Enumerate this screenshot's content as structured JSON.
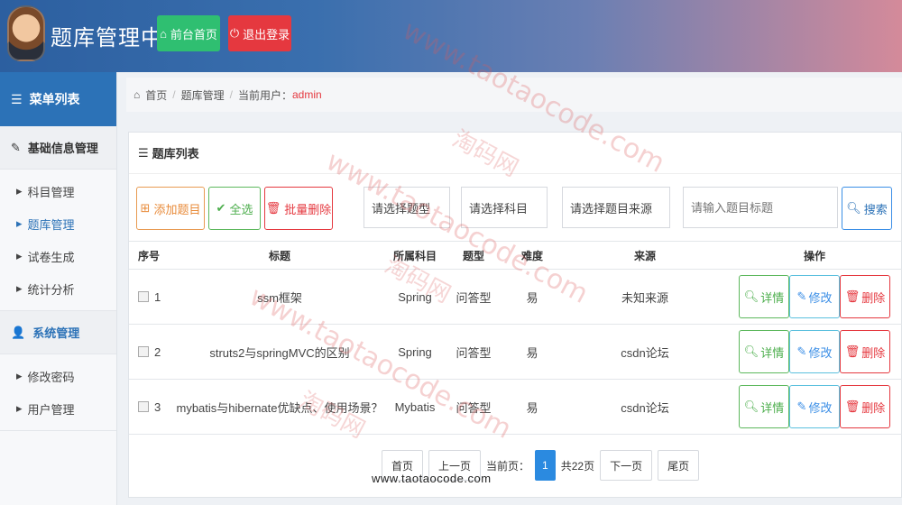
{
  "header": {
    "app_title": "题库管理中心",
    "home_label": "前台首页",
    "logout_label": "退出登录"
  },
  "sidebar": {
    "title": "菜单列表",
    "groups": [
      {
        "label": "基础信息管理",
        "items": [
          "科目管理",
          "题库管理",
          "试卷生成",
          "统计分析"
        ]
      },
      {
        "label": "系统管理",
        "items": [
          "修改密码",
          "用户管理"
        ]
      }
    ]
  },
  "breadcrumb": {
    "home": "首页",
    "section": "题库管理",
    "user_prefix": "当前用户：",
    "user": "admin"
  },
  "panel": {
    "title": "题库列表"
  },
  "toolbar": {
    "add_label": "添加题目",
    "select_all_label": "全选",
    "batch_delete_label": "批量删除",
    "type_select": "请选择题型",
    "subject_select": "请选择科目",
    "source_select": "请选择题目来源",
    "search_placeholder": "请输入题目标题",
    "search_label": "搜索"
  },
  "table": {
    "headers": [
      "序号",
      "标题",
      "所属科目",
      "题型",
      "难度",
      "来源",
      "操作"
    ],
    "rows": [
      {
        "no": "1",
        "title": "ssm框架",
        "subject": "Spring",
        "type": "问答型",
        "difficulty": "易",
        "source": "未知来源"
      },
      {
        "no": "2",
        "title": "struts2与springMVC的区别",
        "subject": "Spring",
        "type": "问答型",
        "difficulty": "易",
        "source": "csdn论坛"
      },
      {
        "no": "3",
        "title": "mybatis与hibernate优缺点、使用场景？",
        "subject": "Mybatis",
        "type": "问答型",
        "difficulty": "易",
        "source": "csdn论坛"
      }
    ],
    "actions": {
      "detail": "详情",
      "edit": "修改",
      "remove": "删除"
    }
  },
  "pager": {
    "first": "首页",
    "prev": "上一页",
    "current_prefix": "当前页：",
    "current": "1",
    "total": "共22页",
    "next": "下一页",
    "last": "尾页"
  },
  "watermark": {
    "site": "www.taotaocode.com",
    "brand": "淘码网"
  },
  "colors": {
    "primary": "#2c72b7",
    "success": "#2fbf71",
    "danger": "#e5383f",
    "warning": "#e88b3a"
  }
}
